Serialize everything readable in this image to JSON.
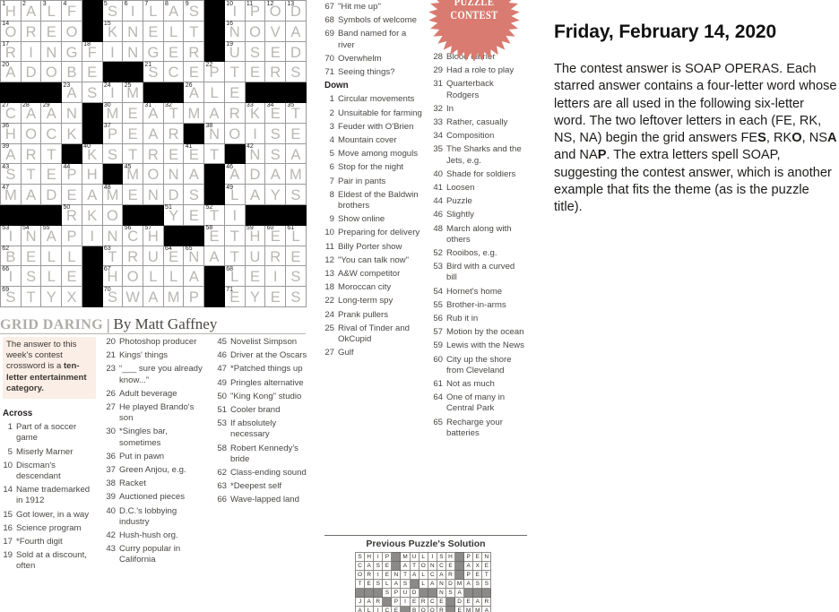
{
  "puzzle": {
    "title": "GRID DARING",
    "separator": "|",
    "byline": "By Matt Gaffney",
    "intro_plain": "The answer to this week's contest crossword is a ten-letter entertainment category.",
    "intro_html": "The answer to this week&rsquo;s contest crossword is a <b>ten-letter entertainment category.</b>",
    "across_heading": "Across",
    "down_heading": "Down"
  },
  "badge": {
    "line1": "PUZZLE",
    "line2": "CONTEST",
    "color": "#d97b70"
  },
  "grid": {
    "cols": 15,
    "rows": 15,
    "letter_color": "#b9b6b2",
    "rows_data": [
      [
        {
          "n": "1",
          "l": "H"
        },
        {
          "n": "2",
          "l": "A"
        },
        {
          "n": "3",
          "l": "L"
        },
        {
          "n": "4",
          "l": "F"
        },
        {
          "blk": true
        },
        {
          "n": "5",
          "l": "S"
        },
        {
          "n": "6",
          "l": "I"
        },
        {
          "n": "7",
          "l": "L"
        },
        {
          "n": "8",
          "l": "A"
        },
        {
          "n": "9",
          "l": "S"
        },
        {
          "blk": true
        },
        {
          "n": "10",
          "l": "I"
        },
        {
          "n": "11",
          "l": "P"
        },
        {
          "n": "12",
          "l": "O"
        },
        {
          "n": "13",
          "l": "D"
        }
      ],
      [
        {
          "n": "14",
          "l": "O"
        },
        {
          "l": "R"
        },
        {
          "l": "E"
        },
        {
          "l": "O"
        },
        {
          "blk": true
        },
        {
          "n": "15",
          "l": "K"
        },
        {
          "l": "N"
        },
        {
          "l": "E"
        },
        {
          "l": "L"
        },
        {
          "l": "T"
        },
        {
          "blk": true
        },
        {
          "n": "16",
          "l": "N"
        },
        {
          "l": "O"
        },
        {
          "l": "V"
        },
        {
          "l": "A"
        }
      ],
      [
        {
          "n": "17",
          "l": "R"
        },
        {
          "l": "I"
        },
        {
          "l": "N"
        },
        {
          "l": "G"
        },
        {
          "n": "18",
          "l": "F"
        },
        {
          "l": "I"
        },
        {
          "l": "N"
        },
        {
          "l": "G"
        },
        {
          "l": "E"
        },
        {
          "l": "R"
        },
        {
          "blk": true
        },
        {
          "n": "19",
          "l": "U"
        },
        {
          "l": "S"
        },
        {
          "l": "E"
        },
        {
          "l": "D"
        }
      ],
      [
        {
          "n": "20",
          "l": "A"
        },
        {
          "l": "D"
        },
        {
          "l": "O"
        },
        {
          "l": "B"
        },
        {
          "l": "E"
        },
        {
          "blk": true
        },
        {
          "blk": true
        },
        {
          "n": "21",
          "l": "S"
        },
        {
          "l": "C"
        },
        {
          "l": "E"
        },
        {
          "n": "22",
          "l": "P"
        },
        {
          "l": "T"
        },
        {
          "l": "E"
        },
        {
          "l": "R"
        },
        {
          "l": "S"
        }
      ],
      [
        {
          "blk": true
        },
        {
          "blk": true
        },
        {
          "blk": true
        },
        {
          "n": "23",
          "l": "A"
        },
        {
          "l": "S"
        },
        {
          "n": "24",
          "l": "I"
        },
        {
          "n": "25",
          "l": "M"
        },
        {
          "blk": true
        },
        {
          "blk": true
        },
        {
          "n": "26",
          "l": "A"
        },
        {
          "l": "L"
        },
        {
          "l": "E"
        },
        {
          "blk": true
        },
        {
          "blk": true
        },
        {
          "blk": true
        }
      ],
      [
        {
          "n": "27",
          "l": "C"
        },
        {
          "n": "28",
          "l": "A"
        },
        {
          "n": "29",
          "l": "A"
        },
        {
          "l": "N"
        },
        {
          "blk": true
        },
        {
          "n": "30",
          "l": "M"
        },
        {
          "l": "E"
        },
        {
          "n": "31",
          "l": "A"
        },
        {
          "n": "32",
          "l": "T"
        },
        {
          "l": "M"
        },
        {
          "l": "A"
        },
        {
          "l": "R"
        },
        {
          "n": "33",
          "l": "K"
        },
        {
          "n": "34",
          "l": "E"
        },
        {
          "n": "35",
          "l": "T"
        }
      ],
      [
        {
          "n": "36",
          "l": "H"
        },
        {
          "l": "O"
        },
        {
          "l": "C"
        },
        {
          "l": "K"
        },
        {
          "blk": true
        },
        {
          "n": "37",
          "l": "P"
        },
        {
          "l": "E"
        },
        {
          "l": "A"
        },
        {
          "l": "R"
        },
        {
          "blk": true
        },
        {
          "n": "38",
          "l": "N"
        },
        {
          "l": "O"
        },
        {
          "l": "I"
        },
        {
          "l": "S"
        },
        {
          "l": "E"
        }
      ],
      [
        {
          "n": "39",
          "l": "A"
        },
        {
          "l": "R"
        },
        {
          "l": "T"
        },
        {
          "blk": true
        },
        {
          "n": "40",
          "l": "K"
        },
        {
          "l": "S"
        },
        {
          "l": "T"
        },
        {
          "l": "R"
        },
        {
          "l": "E"
        },
        {
          "n": "41",
          "l": "E"
        },
        {
          "l": "T"
        },
        {
          "blk": true
        },
        {
          "n": "42",
          "l": "N"
        },
        {
          "l": "S"
        },
        {
          "l": "A"
        }
      ],
      [
        {
          "n": "43",
          "l": "S"
        },
        {
          "l": "T"
        },
        {
          "l": "E"
        },
        {
          "n": "44",
          "l": "P"
        },
        {
          "l": "H"
        },
        {
          "blk": true
        },
        {
          "n": "45",
          "l": "M"
        },
        {
          "l": "O"
        },
        {
          "l": "N"
        },
        {
          "l": "A"
        },
        {
          "blk": true
        },
        {
          "n": "46",
          "l": "A"
        },
        {
          "l": "D"
        },
        {
          "l": "A"
        },
        {
          "l": "M"
        }
      ],
      [
        {
          "n": "47",
          "l": "M"
        },
        {
          "l": "A"
        },
        {
          "l": "D"
        },
        {
          "l": "E"
        },
        {
          "l": "A"
        },
        {
          "n": "48",
          "l": "M"
        },
        {
          "l": "E"
        },
        {
          "l": "N"
        },
        {
          "l": "D"
        },
        {
          "l": "S"
        },
        {
          "blk": true
        },
        {
          "n": "49",
          "l": "L"
        },
        {
          "l": "A"
        },
        {
          "l": "Y"
        },
        {
          "l": "S"
        }
      ],
      [
        {
          "blk": true
        },
        {
          "blk": true
        },
        {
          "blk": true
        },
        {
          "n": "50",
          "l": "R"
        },
        {
          "l": "K"
        },
        {
          "l": "O"
        },
        {
          "blk": true
        },
        {
          "blk": true
        },
        {
          "n": "51",
          "l": "Y"
        },
        {
          "l": "E"
        },
        {
          "n": "52",
          "l": "T"
        },
        {
          "l": "I"
        },
        {
          "blk": true
        },
        {
          "blk": true
        },
        {
          "blk": true
        }
      ],
      [
        {
          "n": "53",
          "l": "I"
        },
        {
          "n": "54",
          "l": "N"
        },
        {
          "n": "55",
          "l": "A"
        },
        {
          "l": "P"
        },
        {
          "l": "I"
        },
        {
          "l": "N"
        },
        {
          "n": "56",
          "l": "C"
        },
        {
          "n": "57",
          "l": "H"
        },
        {
          "blk": true
        },
        {
          "blk": true
        },
        {
          "n": "58",
          "l": "E"
        },
        {
          "l": "T"
        },
        {
          "n": "59",
          "l": "H"
        },
        {
          "n": "60",
          "l": "E"
        },
        {
          "n": "61",
          "l": "L"
        }
      ],
      [
        {
          "n": "62",
          "l": "B"
        },
        {
          "l": "E"
        },
        {
          "l": "L"
        },
        {
          "l": "L"
        },
        {
          "blk": true
        },
        {
          "n": "63",
          "l": "T"
        },
        {
          "l": "R"
        },
        {
          "l": "U"
        },
        {
          "n": "64",
          "l": "E"
        },
        {
          "n": "65",
          "l": "N"
        },
        {
          "l": "A"
        },
        {
          "l": "T"
        },
        {
          "l": "U"
        },
        {
          "l": "R"
        },
        {
          "l": "E"
        }
      ],
      [
        {
          "n": "66",
          "l": "I"
        },
        {
          "l": "S"
        },
        {
          "l": "L"
        },
        {
          "l": "E"
        },
        {
          "blk": true
        },
        {
          "n": "67",
          "l": "H"
        },
        {
          "l": "O"
        },
        {
          "l": "L"
        },
        {
          "l": "L"
        },
        {
          "l": "A"
        },
        {
          "blk": true
        },
        {
          "n": "68",
          "l": "L"
        },
        {
          "l": "E"
        },
        {
          "l": "I"
        },
        {
          "l": "S"
        }
      ],
      [
        {
          "n": "69",
          "l": "S"
        },
        {
          "l": "T"
        },
        {
          "l": "Y"
        },
        {
          "l": "X"
        },
        {
          "blk": true
        },
        {
          "n": "70",
          "l": "S"
        },
        {
          "l": "W"
        },
        {
          "l": "A"
        },
        {
          "l": "M"
        },
        {
          "l": "P"
        },
        {
          "blk": true
        },
        {
          "n": "71",
          "l": "E"
        },
        {
          "l": "Y"
        },
        {
          "l": "E"
        },
        {
          "l": "S"
        }
      ]
    ]
  },
  "clues": {
    "across": [
      {
        "n": "1",
        "t": "Part of a soccer game"
      },
      {
        "n": "5",
        "t": "Miserly Marner"
      },
      {
        "n": "10",
        "t": "Discman's descendant"
      },
      {
        "n": "14",
        "t": "Name trademarked in 1912"
      },
      {
        "n": "15",
        "t": "Got lower, in a way"
      },
      {
        "n": "16",
        "t": "Science program"
      },
      {
        "n": "17",
        "t": "*Fourth digit"
      },
      {
        "n": "19",
        "t": "Sold at a discount, often"
      },
      {
        "n": "20",
        "t": "Photoshop producer"
      },
      {
        "n": "21",
        "t": "Kings' things"
      },
      {
        "n": "23",
        "t": "“___ sure you already know...”"
      },
      {
        "n": "26",
        "t": "Adult beverage"
      },
      {
        "n": "27",
        "t": "He played Brando's son"
      },
      {
        "n": "30",
        "t": "*Singles bar, sometimes"
      },
      {
        "n": "36",
        "t": "Put in pawn"
      },
      {
        "n": "37",
        "t": "Green Anjou, e.g."
      },
      {
        "n": "38",
        "t": "Racket"
      },
      {
        "n": "39",
        "t": "Auctioned pieces"
      },
      {
        "n": "40",
        "t": "D.C.'s lobbying industry"
      },
      {
        "n": "42",
        "t": "Hush-hush org."
      },
      {
        "n": "43",
        "t": "Curry popular in California"
      },
      {
        "n": "45",
        "t": "Novelist Simpson"
      },
      {
        "n": "46",
        "t": "Driver at the Oscars"
      },
      {
        "n": "47",
        "t": "*Patched things up"
      },
      {
        "n": "49",
        "t": "Pringles alternative"
      },
      {
        "n": "50",
        "t": "\"King Kong\" studio"
      },
      {
        "n": "51",
        "t": "Cooler brand"
      },
      {
        "n": "53",
        "t": "If absolutely necessary"
      },
      {
        "n": "58",
        "t": "Robert Kennedy's bride"
      },
      {
        "n": "62",
        "t": "Class-ending sound"
      },
      {
        "n": "63",
        "t": "*Deepest self"
      },
      {
        "n": "66",
        "t": "Wave-lapped land"
      },
      {
        "n": "67",
        "t": "\"Hit me up\""
      },
      {
        "n": "68",
        "t": "Symbols of welcome"
      },
      {
        "n": "69",
        "t": "Band named for a river"
      },
      {
        "n": "70",
        "t": "Overwhelm"
      },
      {
        "n": "71",
        "t": "Seeing things?"
      }
    ],
    "down": [
      {
        "n": "1",
        "t": "Circular movements"
      },
      {
        "n": "2",
        "t": "Unsuitable for farming"
      },
      {
        "n": "3",
        "t": "Feuder with O'Brien"
      },
      {
        "n": "4",
        "t": "Mountain cover"
      },
      {
        "n": "5",
        "t": "Move among moguls"
      },
      {
        "n": "6",
        "t": "Stop for the night"
      },
      {
        "n": "7",
        "t": "Pair in pants"
      },
      {
        "n": "8",
        "t": "Eldest of the Baldwin brothers"
      },
      {
        "n": "9",
        "t": "Show online"
      },
      {
        "n": "10",
        "t": "Preparing for delivery"
      },
      {
        "n": "11",
        "t": "Billy Porter show"
      },
      {
        "n": "12",
        "t": "\"You can talk now\""
      },
      {
        "n": "13",
        "t": "A&W competitor"
      },
      {
        "n": "18",
        "t": "Moroccan city"
      },
      {
        "n": "22",
        "t": "Long-term spy"
      },
      {
        "n": "24",
        "t": "Prank pullers"
      },
      {
        "n": "25",
        "t": "Rival of Tinder and OkCupid"
      },
      {
        "n": "27",
        "t": "Gulf"
      },
      {
        "n": "28",
        "t": "Blood carrier"
      },
      {
        "n": "29",
        "t": "Had a role to play"
      },
      {
        "n": "31",
        "t": "Quarterback Rodgers"
      },
      {
        "n": "32",
        "t": "In"
      },
      {
        "n": "33",
        "t": "Rather, casually"
      },
      {
        "n": "34",
        "t": "Composition"
      },
      {
        "n": "35",
        "t": "The Sharks and the Jets, e.g."
      },
      {
        "n": "40",
        "t": "Shade for soldiers"
      },
      {
        "n": "41",
        "t": "Loosen"
      },
      {
        "n": "44",
        "t": "Puzzle"
      },
      {
        "n": "46",
        "t": "Slightly"
      },
      {
        "n": "48",
        "t": "March along with others"
      },
      {
        "n": "52",
        "t": "Rooibos, e.g."
      },
      {
        "n": "53",
        "t": "Bird with a curved bill"
      },
      {
        "n": "54",
        "t": "Hornet's home"
      },
      {
        "n": "55",
        "t": "Brother-in-arms"
      },
      {
        "n": "56",
        "t": "Rub it in"
      },
      {
        "n": "57",
        "t": "Motion by the ocean"
      },
      {
        "n": "59",
        "t": "Lewis with the News"
      },
      {
        "n": "60",
        "t": "City up the shore from Cleveland"
      },
      {
        "n": "61",
        "t": "Not as much"
      },
      {
        "n": "64",
        "t": "One of many in Central Park"
      },
      {
        "n": "65",
        "t": "Recharge your batteries"
      }
    ]
  },
  "previous_solution": {
    "title": "Previous Puzzle's Solution",
    "rows": [
      [
        "S",
        "H",
        "I",
        "P",
        "#",
        "M",
        "U",
        "L",
        "I",
        "S",
        "H",
        "#",
        "P",
        "E",
        "N"
      ],
      [
        "C",
        "A",
        "S",
        "E",
        "#",
        "A",
        "T",
        "O",
        "N",
        "C",
        "E",
        "#",
        "A",
        "X",
        "E"
      ],
      [
        "O",
        "R",
        "I",
        "E",
        "N",
        "T",
        "A",
        "L",
        "C",
        "A",
        "R",
        "#",
        "P",
        "E",
        "T"
      ],
      [
        "T",
        "E",
        "S",
        "L",
        "A",
        "S",
        "#",
        "L",
        "A",
        "N",
        "D",
        "M",
        "A",
        "S",
        "S"
      ],
      [
        "#",
        "#",
        "#",
        "S",
        "P",
        "U",
        "D",
        "#",
        "#",
        "N",
        "S",
        "A",
        "#",
        "#",
        "#"
      ],
      [
        "J",
        "A",
        "R",
        "#",
        "P",
        "I",
        "E",
        "R",
        "C",
        "E",
        "#",
        "D",
        "E",
        "A",
        "R"
      ],
      [
        "A",
        "L",
        "I",
        "C",
        "E",
        "#",
        "B",
        "O",
        "O",
        "R",
        "#",
        "E",
        "M",
        "M",
        "A"
      ]
    ]
  },
  "right_panel": {
    "date": "Friday, February 14, 2020",
    "answer_html": "The contest answer is SOAP OPERAS. Each starred answer contains a four-letter word whose letters are all used in the following six-letter word. The two leftover letters in each (FE, RK, NS, NA) begin the grid answers FE<b>S</b>, RK<b>O</b>, NS<b>A</b> and NA<b>P</b>. The extra letters spell SOAP, suggesting the contest answer, which is another example that fits the theme (as is the puzzle title).",
    "answer_plain": "The contest answer is SOAP OPERAS. Each starred answer contains a four-letter word whose letters are all used in the following six-letter word. The two leftover letters in each (FE, RK, NS, NA) begin the grid answers FES, RKO, NSA and NAP. The extra letters spell SOAP, suggesting the contest answer, which is another example that fits the theme (as is the puzzle title)."
  }
}
